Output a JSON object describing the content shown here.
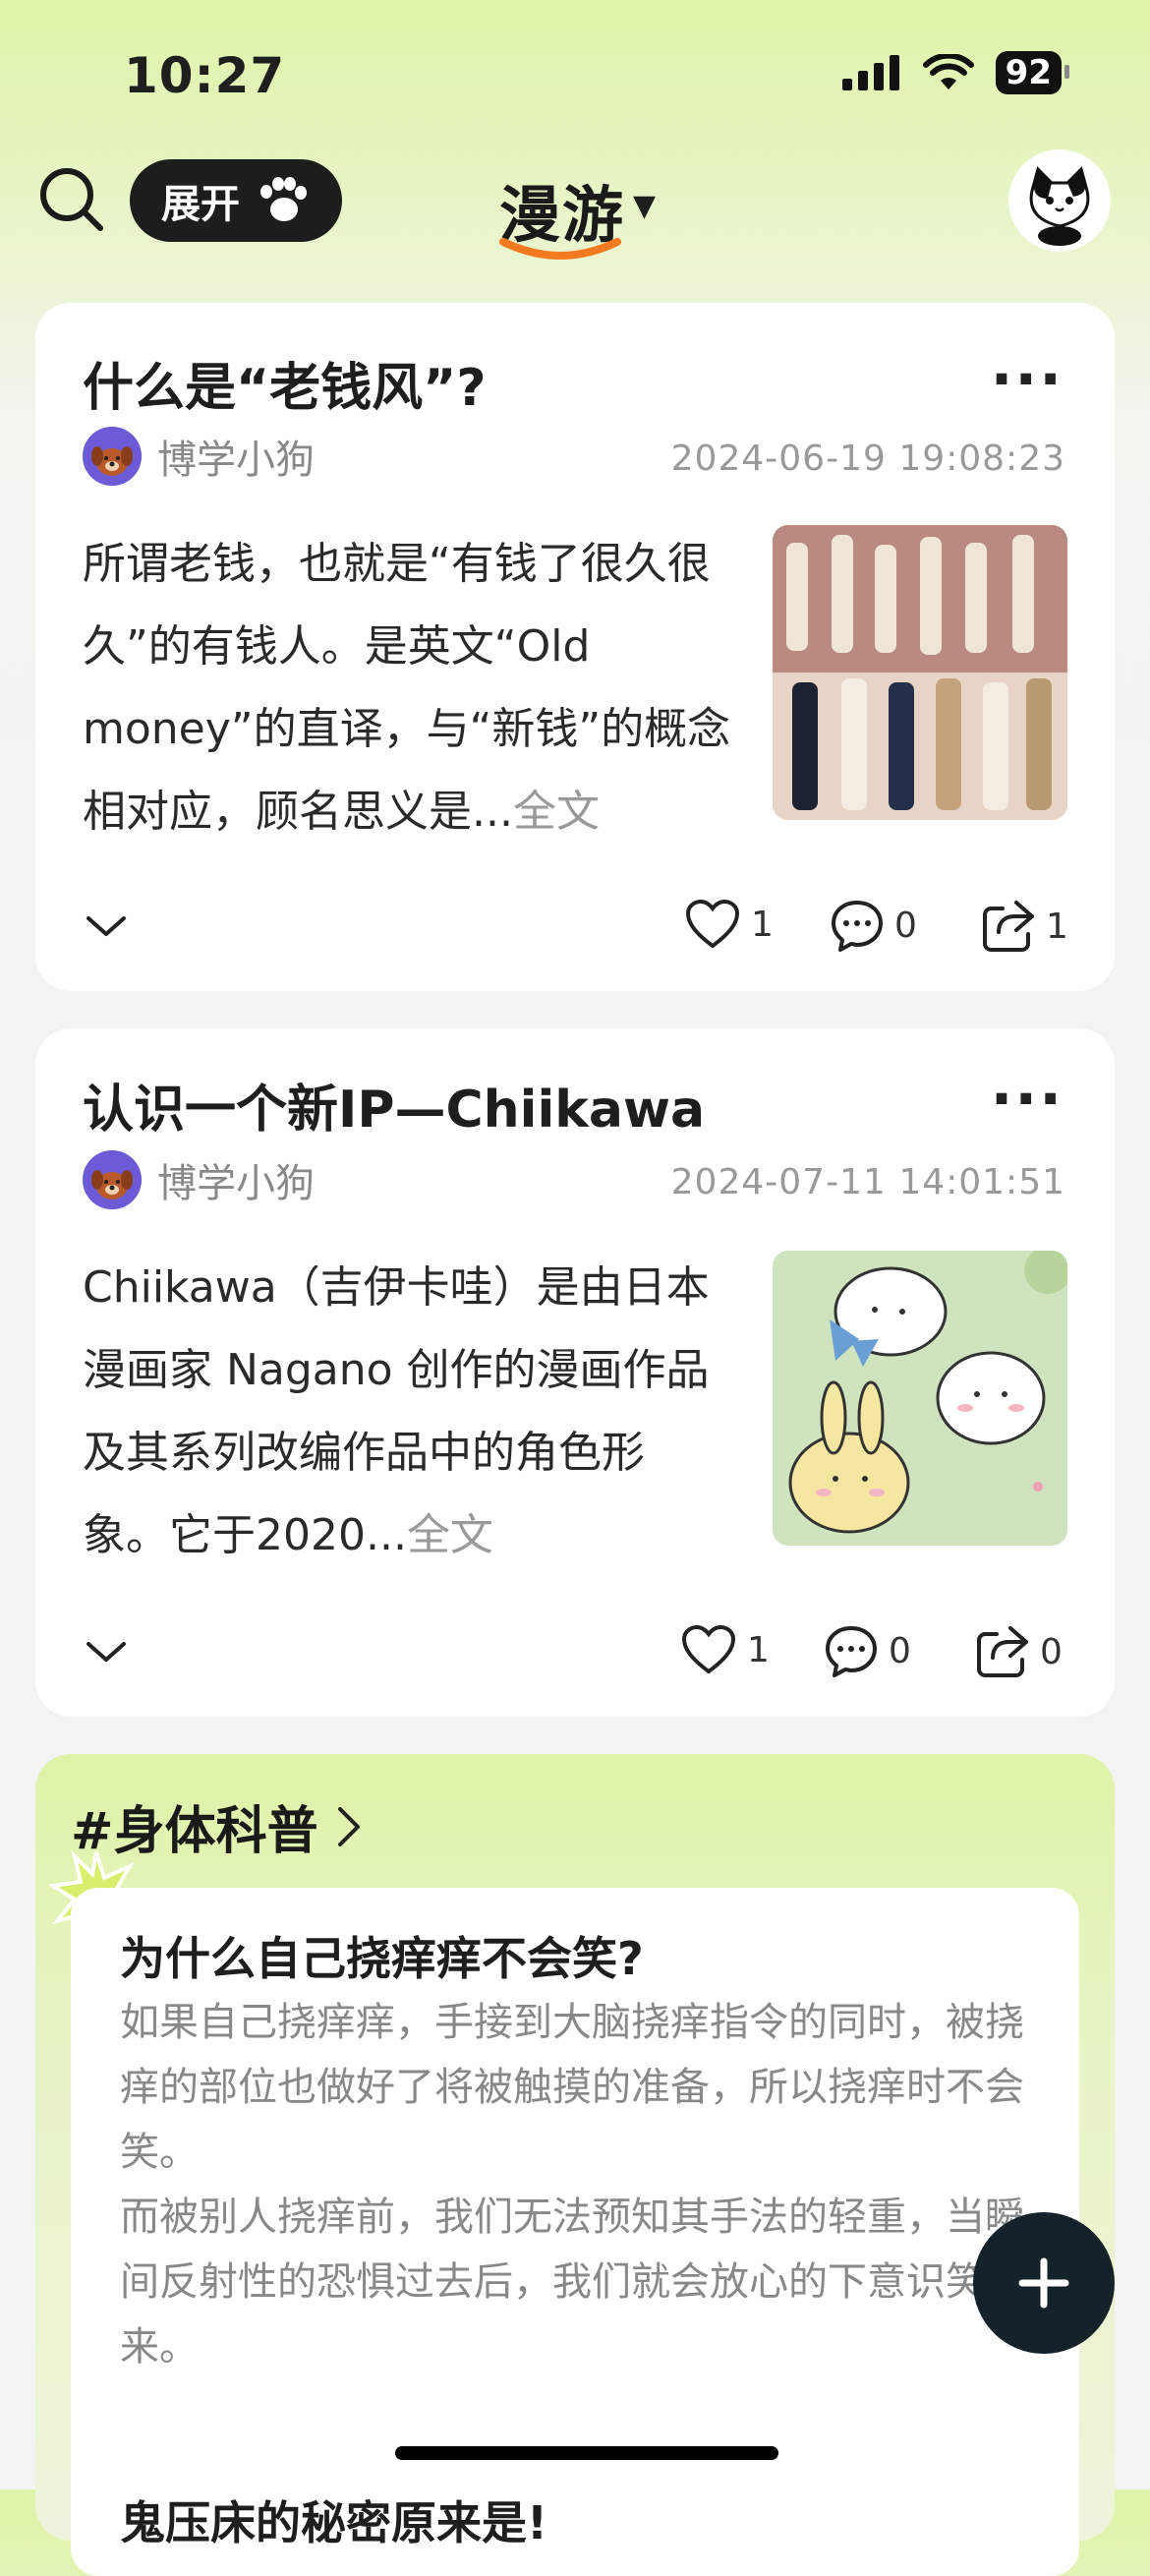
{
  "status": {
    "time": "10:27",
    "battery": "92"
  },
  "header": {
    "expand_label": "展开",
    "title": "漫游",
    "accent": "#f47a1f"
  },
  "posts": [
    {
      "title": "什么是“老钱风”?",
      "author": "博学小狗",
      "time": "2024-06-19 19:08:23",
      "excerpt": "所谓老钱，也就是“有钱了很久很久”的有钱人。是英文“Old money”的直译，与“新钱”的概念相对应，顾名思义是...",
      "full_text_link": "全文",
      "likes": "1",
      "comments": "0",
      "shares": "1"
    },
    {
      "title": "认识一个新IP—Chiikawa",
      "author": "博学小狗",
      "time": "2024-07-11 14:01:51",
      "excerpt": "Chiikawa（吉伊卡哇）是由日本漫画家 Nagano 创作的漫画作品及其系列改编作品中的角色形象。它于2020...",
      "full_text_link": "全文",
      "likes": "1",
      "comments": "0",
      "shares": "0"
    }
  ],
  "topic": {
    "tag": "#身体科普",
    "item1_title": "为什么自己挠痒痒不会笑?",
    "item1_para1": "如果自己挠痒痒，手接到大脑挠痒指令的同时，被挠痒的部位也做好了将被触摸的准备，所以挠痒时不会笑。",
    "item1_para2": "而被别人挠痒前，我们无法预知其手法的轻重，当瞬间反射性的恐惧过去后，我们就会放心的下意识笑起来。",
    "item2_title": "鬼压床的秘密原来是!"
  }
}
